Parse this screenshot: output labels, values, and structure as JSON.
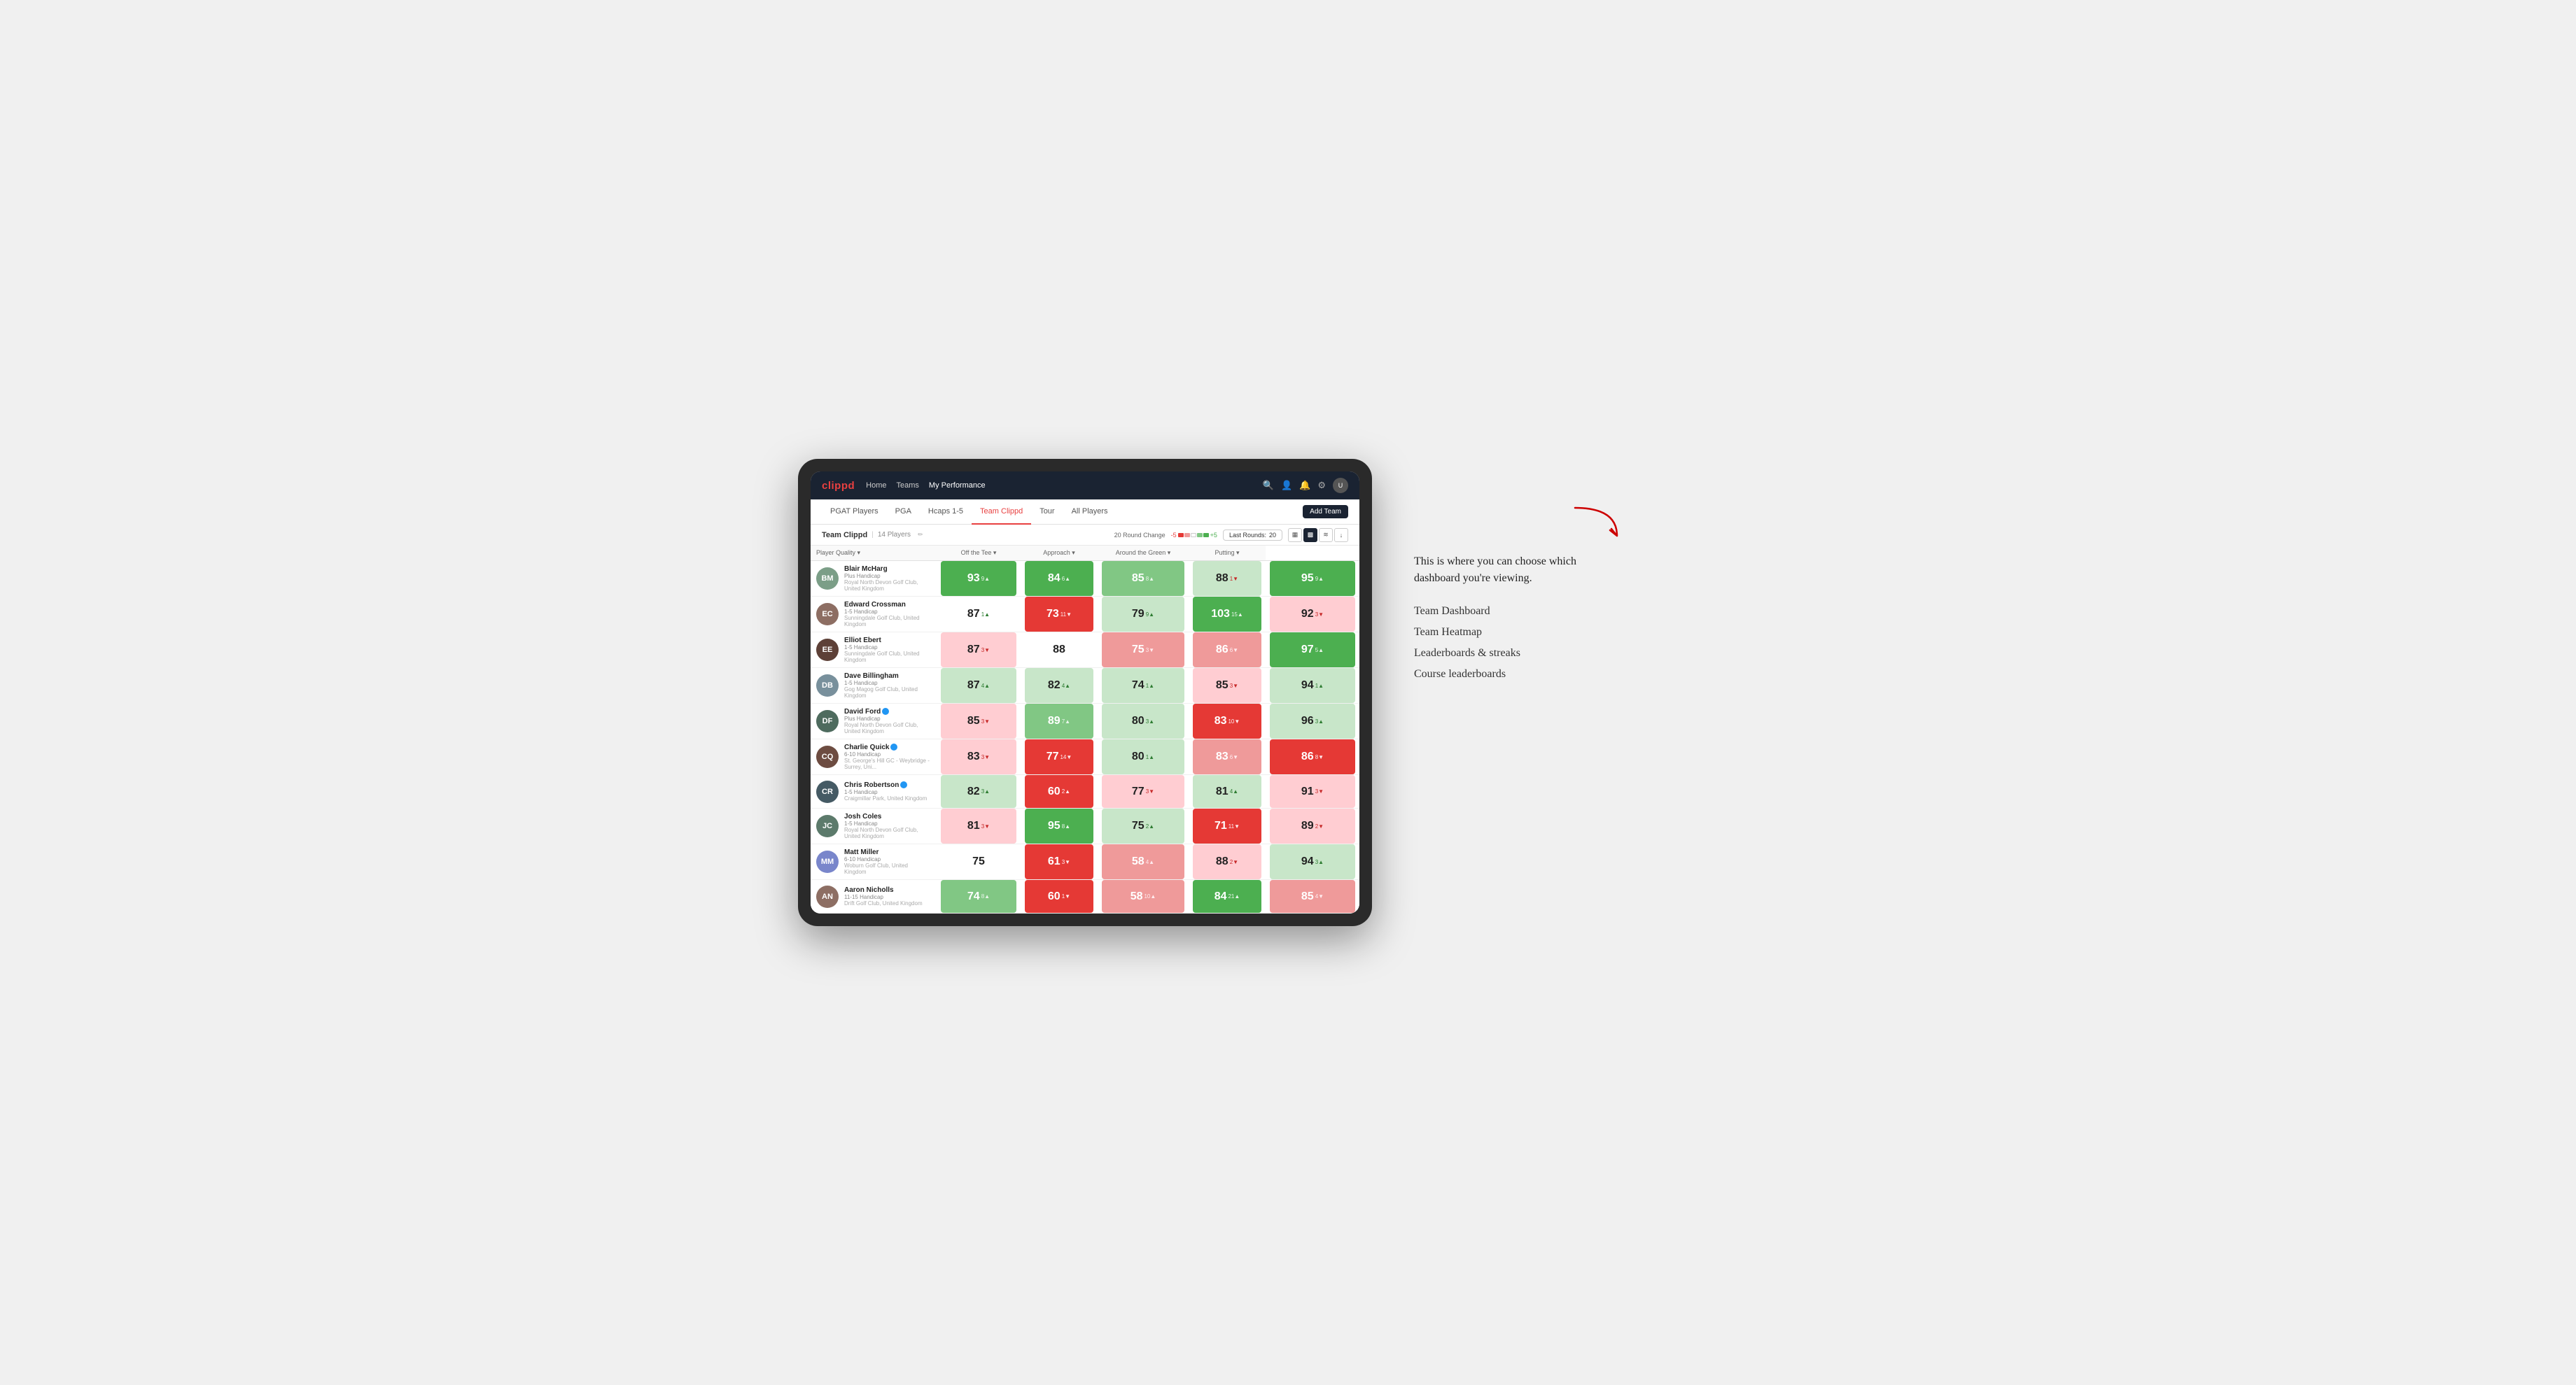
{
  "annotation": {
    "intro_text": "This is where you can choose which dashboard you're viewing.",
    "items": [
      {
        "label": "Team Dashboard"
      },
      {
        "label": "Team Heatmap"
      },
      {
        "label": "Leaderboards & streaks"
      },
      {
        "label": "Course leaderboards"
      }
    ]
  },
  "nav": {
    "logo": "clippd",
    "links": [
      {
        "label": "Home",
        "active": false
      },
      {
        "label": "Teams",
        "active": false
      },
      {
        "label": "My Performance",
        "active": true
      }
    ],
    "icons": [
      "search",
      "user",
      "bell",
      "settings",
      "avatar"
    ]
  },
  "sub_nav": {
    "tabs": [
      {
        "label": "PGAT Players",
        "active": false
      },
      {
        "label": "PGA",
        "active": false
      },
      {
        "label": "Hcaps 1-5",
        "active": false
      },
      {
        "label": "Team Clippd",
        "active": true
      },
      {
        "label": "Tour",
        "active": false
      },
      {
        "label": "All Players",
        "active": false
      }
    ],
    "add_team_label": "Add Team"
  },
  "team_header": {
    "title": "Team Clippd",
    "separator": "|",
    "count_label": "14 Players",
    "round_change_label": "20 Round Change",
    "scale_neg": "-5",
    "scale_pos": "+5",
    "last_rounds_label": "Last Rounds:",
    "last_rounds_value": "20",
    "view_options": [
      "grid-small",
      "grid-large",
      "heatmap",
      "download"
    ]
  },
  "table": {
    "columns": [
      {
        "label": "Player Quality ▾",
        "key": "player_quality"
      },
      {
        "label": "Off the Tee ▾",
        "key": "off_tee"
      },
      {
        "label": "Approach ▾",
        "key": "approach"
      },
      {
        "label": "Around the Green ▾",
        "key": "around_green"
      },
      {
        "label": "Putting ▾",
        "key": "putting"
      }
    ],
    "players": [
      {
        "name": "Blair McHarg",
        "handicap": "Plus Handicap",
        "club": "Royal North Devon Golf Club, United Kingdom",
        "avatar_initials": "BM",
        "avatar_color": "#7b9e87",
        "player_quality": {
          "value": "93",
          "change": "9",
          "dir": "up",
          "bg": "bg-green-strong"
        },
        "off_tee": {
          "value": "84",
          "change": "6",
          "dir": "up",
          "bg": "bg-green-strong"
        },
        "approach": {
          "value": "85",
          "change": "8",
          "dir": "up",
          "bg": "bg-green-medium"
        },
        "around_green": {
          "value": "88",
          "change": "1",
          "dir": "down",
          "bg": "bg-green-light"
        },
        "putting": {
          "value": "95",
          "change": "9",
          "dir": "up",
          "bg": "bg-green-strong"
        }
      },
      {
        "name": "Edward Crossman",
        "handicap": "1-5 Handicap",
        "club": "Sunningdale Golf Club, United Kingdom",
        "avatar_initials": "EC",
        "avatar_color": "#8d6e63",
        "player_quality": {
          "value": "87",
          "change": "1",
          "dir": "up",
          "bg": "bg-white"
        },
        "off_tee": {
          "value": "73",
          "change": "11",
          "dir": "down",
          "bg": "bg-red-strong"
        },
        "approach": {
          "value": "79",
          "change": "9",
          "dir": "up",
          "bg": "bg-green-light"
        },
        "around_green": {
          "value": "103",
          "change": "15",
          "dir": "up",
          "bg": "bg-green-strong"
        },
        "putting": {
          "value": "92",
          "change": "3",
          "dir": "down",
          "bg": "bg-red-light"
        }
      },
      {
        "name": "Elliot Ebert",
        "handicap": "1-5 Handicap",
        "club": "Sunningdale Golf Club, United Kingdom",
        "avatar_initials": "EE",
        "avatar_color": "#5d4037",
        "player_quality": {
          "value": "87",
          "change": "3",
          "dir": "down",
          "bg": "bg-red-light"
        },
        "off_tee": {
          "value": "88",
          "change": "",
          "dir": "",
          "bg": "bg-white"
        },
        "approach": {
          "value": "75",
          "change": "3",
          "dir": "down",
          "bg": "bg-red-medium"
        },
        "around_green": {
          "value": "86",
          "change": "6",
          "dir": "down",
          "bg": "bg-red-medium"
        },
        "putting": {
          "value": "97",
          "change": "5",
          "dir": "up",
          "bg": "bg-green-strong"
        }
      },
      {
        "name": "Dave Billingham",
        "handicap": "1-5 Handicap",
        "club": "Gog Magog Golf Club, United Kingdom",
        "avatar_initials": "DB",
        "avatar_color": "#78909c",
        "player_quality": {
          "value": "87",
          "change": "4",
          "dir": "up",
          "bg": "bg-green-light"
        },
        "off_tee": {
          "value": "82",
          "change": "4",
          "dir": "up",
          "bg": "bg-green-light"
        },
        "approach": {
          "value": "74",
          "change": "1",
          "dir": "up",
          "bg": "bg-green-light"
        },
        "around_green": {
          "value": "85",
          "change": "3",
          "dir": "down",
          "bg": "bg-red-light"
        },
        "putting": {
          "value": "94",
          "change": "1",
          "dir": "up",
          "bg": "bg-green-light"
        }
      },
      {
        "name": "David Ford",
        "handicap": "Plus Handicap",
        "club": "Royal North Devon Golf Club, United Kingdom",
        "avatar_initials": "DF",
        "avatar_color": "#4e6b5e",
        "verified": true,
        "player_quality": {
          "value": "85",
          "change": "3",
          "dir": "down",
          "bg": "bg-red-light"
        },
        "off_tee": {
          "value": "89",
          "change": "7",
          "dir": "up",
          "bg": "bg-green-medium"
        },
        "approach": {
          "value": "80",
          "change": "3",
          "dir": "up",
          "bg": "bg-green-light"
        },
        "around_green": {
          "value": "83",
          "change": "10",
          "dir": "down",
          "bg": "bg-red-strong"
        },
        "putting": {
          "value": "96",
          "change": "3",
          "dir": "up",
          "bg": "bg-green-light"
        }
      },
      {
        "name": "Charlie Quick",
        "handicap": "6-10 Handicap",
        "club": "St. George's Hill GC - Weybridge - Surrey, Uni...",
        "avatar_initials": "CQ",
        "avatar_color": "#6d4c41",
        "verified": true,
        "player_quality": {
          "value": "83",
          "change": "3",
          "dir": "down",
          "bg": "bg-red-light"
        },
        "off_tee": {
          "value": "77",
          "change": "14",
          "dir": "down",
          "bg": "bg-red-strong"
        },
        "approach": {
          "value": "80",
          "change": "1",
          "dir": "up",
          "bg": "bg-green-light"
        },
        "around_green": {
          "value": "83",
          "change": "6",
          "dir": "down",
          "bg": "bg-red-medium"
        },
        "putting": {
          "value": "86",
          "change": "8",
          "dir": "down",
          "bg": "bg-red-strong"
        }
      },
      {
        "name": "Chris Robertson",
        "handicap": "1-5 Handicap",
        "club": "Craigmillar Park, United Kingdom",
        "avatar_initials": "CR",
        "avatar_color": "#455a64",
        "verified": true,
        "player_quality": {
          "value": "82",
          "change": "3",
          "dir": "up",
          "bg": "bg-green-light"
        },
        "off_tee": {
          "value": "60",
          "change": "2",
          "dir": "up",
          "bg": "bg-red-strong"
        },
        "approach": {
          "value": "77",
          "change": "3",
          "dir": "down",
          "bg": "bg-red-light"
        },
        "around_green": {
          "value": "81",
          "change": "4",
          "dir": "up",
          "bg": "bg-green-light"
        },
        "putting": {
          "value": "91",
          "change": "3",
          "dir": "down",
          "bg": "bg-red-light"
        }
      },
      {
        "name": "Josh Coles",
        "handicap": "1-5 Handicap",
        "club": "Royal North Devon Golf Club, United Kingdom",
        "avatar_initials": "JC",
        "avatar_color": "#5c7a6b",
        "player_quality": {
          "value": "81",
          "change": "3",
          "dir": "down",
          "bg": "bg-red-light"
        },
        "off_tee": {
          "value": "95",
          "change": "8",
          "dir": "up",
          "bg": "bg-green-strong"
        },
        "approach": {
          "value": "75",
          "change": "2",
          "dir": "up",
          "bg": "bg-green-light"
        },
        "around_green": {
          "value": "71",
          "change": "11",
          "dir": "down",
          "bg": "bg-red-strong"
        },
        "putting": {
          "value": "89",
          "change": "2",
          "dir": "down",
          "bg": "bg-red-light"
        }
      },
      {
        "name": "Matt Miller",
        "handicap": "6-10 Handicap",
        "club": "Woburn Golf Club, United Kingdom",
        "avatar_initials": "MM",
        "avatar_color": "#7986cb",
        "player_quality": {
          "value": "75",
          "change": "",
          "dir": "",
          "bg": "bg-white"
        },
        "off_tee": {
          "value": "61",
          "change": "3",
          "dir": "down",
          "bg": "bg-red-strong"
        },
        "approach": {
          "value": "58",
          "change": "4",
          "dir": "up",
          "bg": "bg-red-medium"
        },
        "around_green": {
          "value": "88",
          "change": "2",
          "dir": "down",
          "bg": "bg-red-light"
        },
        "putting": {
          "value": "94",
          "change": "3",
          "dir": "up",
          "bg": "bg-green-light"
        }
      },
      {
        "name": "Aaron Nicholls",
        "handicap": "11-15 Handicap",
        "club": "Drift Golf Club, United Kingdom",
        "avatar_initials": "AN",
        "avatar_color": "#8d6e63",
        "player_quality": {
          "value": "74",
          "change": "8",
          "dir": "up",
          "bg": "bg-green-medium"
        },
        "off_tee": {
          "value": "60",
          "change": "1",
          "dir": "down",
          "bg": "bg-red-strong"
        },
        "approach": {
          "value": "58",
          "change": "10",
          "dir": "up",
          "bg": "bg-red-medium"
        },
        "around_green": {
          "value": "84",
          "change": "21",
          "dir": "up",
          "bg": "bg-green-strong"
        },
        "putting": {
          "value": "85",
          "change": "4",
          "dir": "down",
          "bg": "bg-red-medium"
        }
      }
    ]
  }
}
